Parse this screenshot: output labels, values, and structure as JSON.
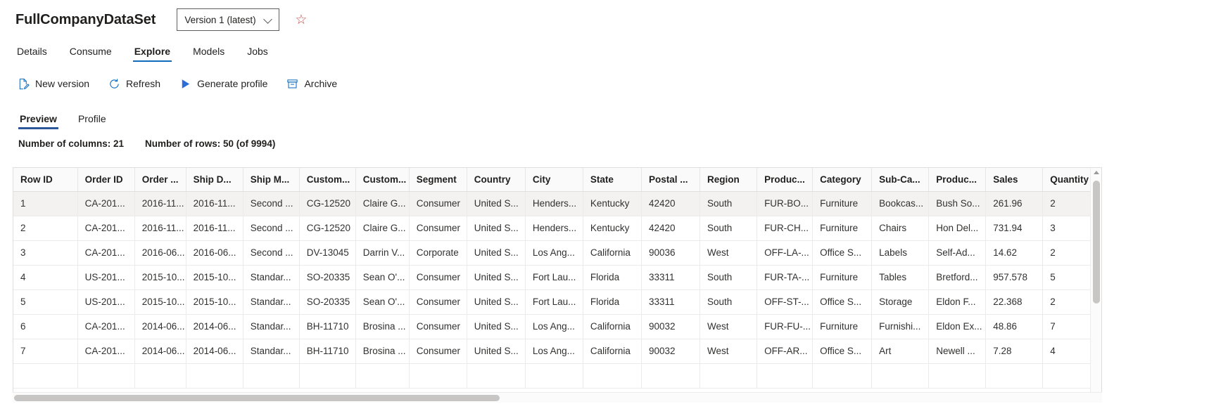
{
  "header": {
    "title": "FullCompanyDataSet",
    "version_label": "Version 1 (latest)",
    "favorite_icon": "☆"
  },
  "tabs": [
    {
      "label": "Details",
      "selected": false
    },
    {
      "label": "Consume",
      "selected": false
    },
    {
      "label": "Explore",
      "selected": true
    },
    {
      "label": "Models",
      "selected": false
    },
    {
      "label": "Jobs",
      "selected": false
    }
  ],
  "commands": [
    {
      "label": "New version",
      "icon": "new-version-icon"
    },
    {
      "label": "Refresh",
      "icon": "refresh-icon"
    },
    {
      "label": "Generate profile",
      "icon": "play-icon"
    },
    {
      "label": "Archive",
      "icon": "archive-icon"
    }
  ],
  "subtabs": [
    {
      "label": "Preview",
      "selected": true
    },
    {
      "label": "Profile",
      "selected": false
    }
  ],
  "stats": {
    "columns": "Number of columns: 21",
    "rows": "Number of rows: 50 (of 9994)"
  },
  "grid": {
    "columns": [
      "Row ID",
      "Order ID",
      "Order ...",
      "Ship D...",
      "Ship M...",
      "Custom...",
      "Custom...",
      "Segment",
      "Country",
      "City",
      "State",
      "Postal ...",
      "Region",
      "Produc...",
      "Category",
      "Sub-Ca...",
      "Produc...",
      "Sales",
      "Quantity"
    ],
    "rows": [
      {
        "selected": true,
        "cells": [
          "1",
          "CA-201...",
          "2016-11...",
          "2016-11...",
          "Second ...",
          "CG-12520",
          "Claire G...",
          "Consumer",
          "United S...",
          "Henders...",
          "Kentucky",
          "42420",
          "South",
          "FUR-BO...",
          "Furniture",
          "Bookcas...",
          "Bush So...",
          "261.96",
          "2"
        ]
      },
      {
        "selected": false,
        "cells": [
          "2",
          "CA-201...",
          "2016-11...",
          "2016-11...",
          "Second ...",
          "CG-12520",
          "Claire G...",
          "Consumer",
          "United S...",
          "Henders...",
          "Kentucky",
          "42420",
          "South",
          "FUR-CH...",
          "Furniture",
          "Chairs",
          "Hon Del...",
          "731.94",
          "3"
        ]
      },
      {
        "selected": false,
        "cells": [
          "3",
          "CA-201...",
          "2016-06...",
          "2016-06...",
          "Second ...",
          "DV-13045",
          "Darrin V...",
          "Corporate",
          "United S...",
          "Los Ang...",
          "California",
          "90036",
          "West",
          "OFF-LA-...",
          "Office S...",
          "Labels",
          "Self-Ad...",
          "14.62",
          "2"
        ]
      },
      {
        "selected": false,
        "cells": [
          "4",
          "US-201...",
          "2015-10...",
          "2015-10...",
          "Standar...",
          "SO-20335",
          "Sean O'...",
          "Consumer",
          "United S...",
          "Fort Lau...",
          "Florida",
          "33311",
          "South",
          "FUR-TA-...",
          "Furniture",
          "Tables",
          "Bretford...",
          "957.578",
          "5"
        ]
      },
      {
        "selected": false,
        "cells": [
          "5",
          "US-201...",
          "2015-10...",
          "2015-10...",
          "Standar...",
          "SO-20335",
          "Sean O'...",
          "Consumer",
          "United S...",
          "Fort Lau...",
          "Florida",
          "33311",
          "South",
          "OFF-ST-...",
          "Office S...",
          "Storage",
          "Eldon F...",
          "22.368",
          "2"
        ]
      },
      {
        "selected": false,
        "cells": [
          "6",
          "CA-201...",
          "2014-06...",
          "2014-06...",
          "Standar...",
          "BH-11710",
          "Brosina ...",
          "Consumer",
          "United S...",
          "Los Ang...",
          "California",
          "90032",
          "West",
          "FUR-FU-...",
          "Furniture",
          "Furnishi...",
          "Eldon Ex...",
          "48.86",
          "7"
        ]
      },
      {
        "selected": false,
        "cells": [
          "7",
          "CA-201...",
          "2014-06...",
          "2014-06...",
          "Standar...",
          "BH-11710",
          "Brosina ...",
          "Consumer",
          "United S...",
          "Los Ang...",
          "California",
          "90032",
          "West",
          "OFF-AR...",
          "Office S...",
          "Art",
          "Newell ...",
          "7.28",
          "4"
        ]
      },
      {
        "selected": false,
        "cells": [
          "",
          "",
          "",
          "",
          "",
          "",
          "",
          "",
          "",
          "",
          "",
          "",
          "",
          "",
          "",
          "",
          "",
          "",
          ""
        ]
      }
    ]
  },
  "colors": {
    "accent": "#0f6cbd",
    "subtab_accent": "#2b579a",
    "favorite": "#c25050",
    "selected_row": "#f3f2f1"
  }
}
